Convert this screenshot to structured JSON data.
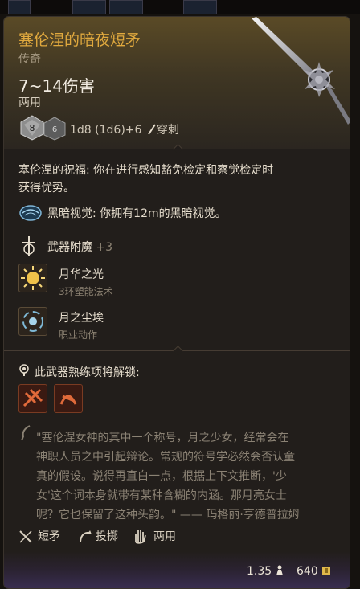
{
  "item": {
    "name": "塞伦涅的暗夜短矛",
    "rarity": "传奇",
    "damage": "7~14伤害",
    "handedness": "两用",
    "dice_primary": "8",
    "dice_secondary": "6",
    "dice_formula": "1d8 (1d6)+6",
    "damage_type": "穿刺"
  },
  "blessing": {
    "title": "塞伦涅的祝福:",
    "text_line1": "你在进行感知豁免检定和察觉检定时",
    "text_line2": "获得优势。"
  },
  "darkvision": {
    "title": "黑暗视觉:",
    "text": "你拥有12m的黑暗视觉。"
  },
  "enchant": {
    "label": "武器附魔",
    "bonus": "+3"
  },
  "spells": [
    {
      "name": "月华之光",
      "sub": "3环塑能法术",
      "icon": "moonbeam-icon"
    },
    {
      "name": "月之尘埃",
      "sub": "职业动作",
      "icon": "moon-dust-icon"
    }
  ],
  "proficiency": {
    "label": "此武器熟练项将解锁:"
  },
  "lore": {
    "lines": [
      "\"塞伦涅女神的其中一个称号，月之少女，经常会在",
      "神职人员之中引起辩论。常规的符号学必然会否认童",
      "真的假设。说得再直白一点，根据上下文推断，'少",
      "女'这个词本身就带有某种含糊的内涵。那月亮女士",
      "呢？它也保留了这种头韵。\" —— 玛格丽·亨德普拉姆"
    ]
  },
  "properties": [
    {
      "label": "短矛",
      "icon": "spear-icon"
    },
    {
      "label": "投掷",
      "icon": "throw-icon"
    },
    {
      "label": "两用",
      "icon": "hand-icon"
    }
  ],
  "footer": {
    "weight": "1.35",
    "value": "640"
  },
  "colors": {
    "title": "#e0a93e",
    "background": "#221e1b",
    "accent_purple": "#3a2e52"
  }
}
